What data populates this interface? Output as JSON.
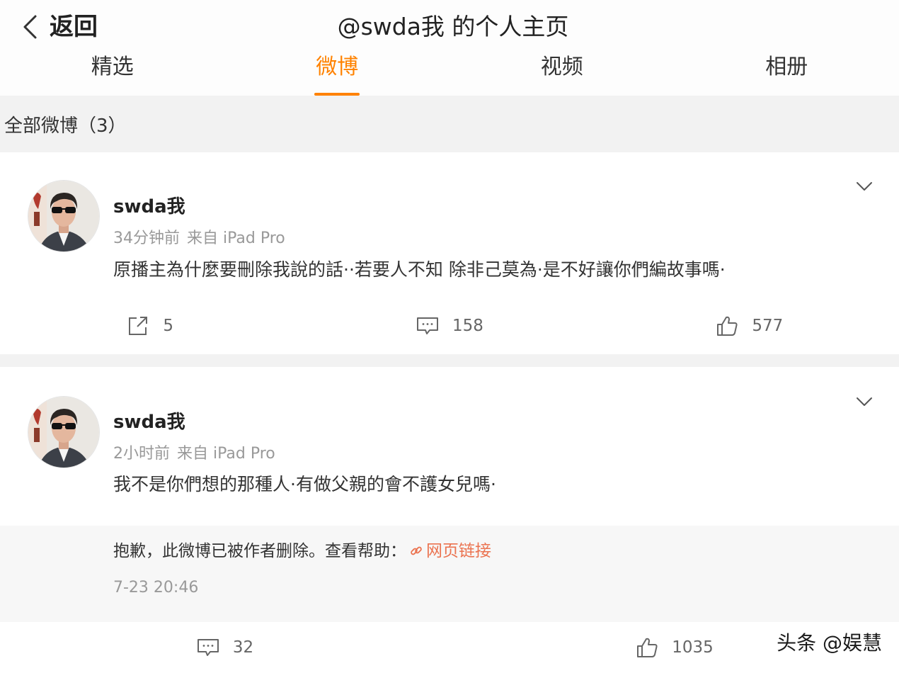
{
  "header": {
    "back_label": "返回",
    "title": "@swda我 的个人主页"
  },
  "tabs": [
    {
      "label": "精选",
      "active": false
    },
    {
      "label": "微博",
      "active": true
    },
    {
      "label": "视频",
      "active": false
    },
    {
      "label": "相册",
      "active": false
    }
  ],
  "feed": {
    "title": "全部微博（3）"
  },
  "posts": [
    {
      "author": "swda我",
      "time": "34分钟前",
      "source": "来自 iPad Pro",
      "content": "原播主為什麼要刪除我說的話··若要人不知 除非己莫為·是不好讓你們編故事嗎·",
      "repost_count": "5",
      "comment_count": "158",
      "like_count": "577"
    },
    {
      "author": "swda我",
      "time": "2小时前",
      "source": "来自 iPad Pro",
      "content": "我不是你們想的那種人·有做父親的會不護女兒嗎·",
      "quoted": {
        "notice": "抱歉，此微博已被作者删除。查看帮助：",
        "link_label": "网页链接",
        "date": "7-23 20:46"
      },
      "comment_count": "32",
      "like_count": "1035"
    }
  ],
  "watermark": "头条 @娱慧",
  "icons": {
    "back": "chevron-left-icon",
    "more": "chevron-down-icon",
    "repost": "share-icon",
    "comment": "comment-icon",
    "like": "thumbs-up-icon",
    "link": "link-icon"
  },
  "colors": {
    "accent": "#ff8200",
    "link": "#eb7350",
    "text": "#333333",
    "secondary_text": "#999999",
    "page_background": "#f2f2f2"
  }
}
